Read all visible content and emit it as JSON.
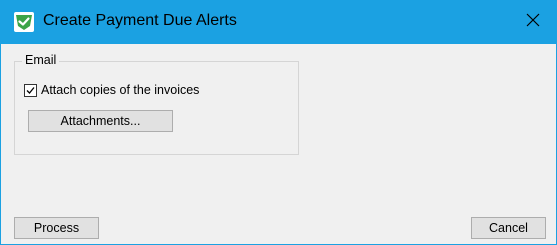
{
  "window": {
    "title": "Create Payment Due Alerts",
    "titlebar_color": "#1ba1e2",
    "app_icon": "green-check-shield-icon",
    "close_icon": "close-icon"
  },
  "email_group": {
    "label": "Email",
    "attach_checkbox": {
      "label": "Attach copies of the invoices",
      "checked": true
    },
    "attachments_button": "Attachments..."
  },
  "footer": {
    "process_button": "Process",
    "cancel_button": "Cancel"
  }
}
